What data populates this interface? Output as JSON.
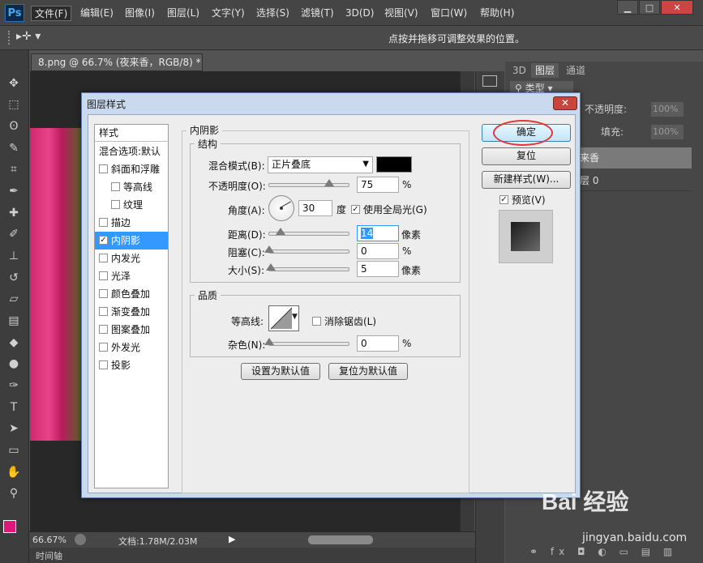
{
  "app": {
    "logo": "Ps"
  },
  "menu": [
    "文件(F)",
    "编辑(E)",
    "图像(I)",
    "图层(L)",
    "文字(Y)",
    "选择(S)",
    "滤镜(T)",
    "3D(D)",
    "视图(V)",
    "窗口(W)",
    "帮助(H)"
  ],
  "window_controls": {
    "minimize": "▁",
    "maximize": "□",
    "close": "✕"
  },
  "options_bar": {
    "hint": "点按并拖移可调整效果的位置。"
  },
  "document": {
    "tab_title": "8.png @ 66.7% (夜来香，RGB/8) *",
    "tab_close": "×"
  },
  "status": {
    "zoom": "66.67%",
    "doc_size": "文档:1.78M/2.03M"
  },
  "timeline": {
    "label": "时间轴"
  },
  "panels": {
    "tabs": [
      "3D",
      "图层",
      "通道"
    ],
    "filter_label": "类型",
    "opacity_label": "不透明度:",
    "opacity_value": "100%",
    "fill_label": "填充:",
    "fill_value": "100%",
    "layer_1": "来香",
    "layer_2": "层 0"
  },
  "dialog": {
    "title": "图层样式",
    "close": "✕",
    "style_list": {
      "header": "样式",
      "items": [
        {
          "label": "混合选项:默认",
          "checkbox": false,
          "checked": false,
          "indent": false
        },
        {
          "label": "斜面和浮雕",
          "checkbox": true,
          "checked": false,
          "indent": false
        },
        {
          "label": "等高线",
          "checkbox": true,
          "checked": false,
          "indent": true
        },
        {
          "label": "纹理",
          "checkbox": true,
          "checked": false,
          "indent": true
        },
        {
          "label": "描边",
          "checkbox": true,
          "checked": false,
          "indent": false
        },
        {
          "label": "内阴影",
          "checkbox": true,
          "checked": true,
          "indent": false,
          "selected": true
        },
        {
          "label": "内发光",
          "checkbox": true,
          "checked": false,
          "indent": false
        },
        {
          "label": "光泽",
          "checkbox": true,
          "checked": false,
          "indent": false
        },
        {
          "label": "颜色叠加",
          "checkbox": true,
          "checked": false,
          "indent": false
        },
        {
          "label": "渐变叠加",
          "checkbox": true,
          "checked": false,
          "indent": false
        },
        {
          "label": "图案叠加",
          "checkbox": true,
          "checked": false,
          "indent": false
        },
        {
          "label": "外发光",
          "checkbox": true,
          "checked": false,
          "indent": false
        },
        {
          "label": "投影",
          "checkbox": true,
          "checked": false,
          "indent": false
        }
      ]
    },
    "section_title": "内阴影",
    "structure": {
      "title": "结构",
      "blend_mode_label": "混合模式(B):",
      "blend_mode_value": "正片叠底",
      "shadow_color": "#000000",
      "opacity_label": "不透明度(O):",
      "opacity_value": "75",
      "opacity_unit": "%",
      "angle_label": "角度(A):",
      "angle_value": "30",
      "angle_unit": "度",
      "global_light_label": "使用全局光(G)",
      "global_light_checked": true,
      "distance_label": "距离(D):",
      "distance_value": "14",
      "distance_unit": "像素",
      "choke_label": "阻塞(C):",
      "choke_value": "0",
      "choke_unit": "%",
      "size_label": "大小(S):",
      "size_value": "5",
      "size_unit": "像素"
    },
    "quality": {
      "title": "品质",
      "contour_label": "等高线:",
      "antialias_label": "消除锯齿(L)",
      "antialias_checked": false,
      "noise_label": "杂色(N):",
      "noise_value": "0",
      "noise_unit": "%"
    },
    "make_default": "设置为默认值",
    "reset_default": "复位为默认值",
    "buttons": {
      "ok": "确定",
      "reset": "复位",
      "new_style": "新建样式(W)..."
    },
    "preview_label": "预览(V)",
    "preview_checked": true
  },
  "watermark": {
    "brand": "Bai 经验",
    "url": "jingyan.baidu.com"
  }
}
